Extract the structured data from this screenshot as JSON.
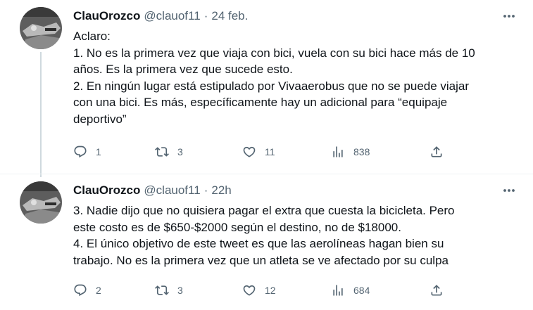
{
  "tweets": [
    {
      "author_name": "ClauOrozco",
      "handle": "@clauof11",
      "separator": "·",
      "time": "24 feb.",
      "lines": [
        "Aclaro:",
        "1. No es la primera vez que viaja con bici, vuela con su bici hace más de 10",
        "años. Es la primera vez que sucede esto.",
        "2. En ningún lugar está estipulado por Vivaaerobus que no se puede viajar",
        "con una bici. Es más, específicamente hay un adicional para “equipaje",
        "deportivo”"
      ],
      "replies": "1",
      "retweets": "3",
      "likes": "11",
      "views": "838"
    },
    {
      "author_name": "ClauOrozco",
      "handle": "@clauof11",
      "separator": "·",
      "time": "22h",
      "lines": [
        "3. Nadie dijo que no quisiera pagar el extra que cuesta la bicicleta. Pero",
        "este costo es de $650-$2000 según el destino, no de $18000.",
        "4. El único objetivo de este tweet es que las aerolíneas hagan bien su",
        "trabajo. No es la primera vez que un atleta se ve afectado por su culpa"
      ],
      "replies": "2",
      "retweets": "3",
      "likes": "12",
      "views": "684"
    }
  ],
  "icons": {
    "reply": "reply-icon",
    "retweet": "retweet-icon",
    "like": "heart-icon",
    "views": "views-chart-icon",
    "share": "share-icon",
    "more": "more-dots-icon"
  },
  "colors": {
    "text_primary": "#0f1419",
    "text_secondary": "#536471",
    "thread_line": "#cfd9de"
  }
}
